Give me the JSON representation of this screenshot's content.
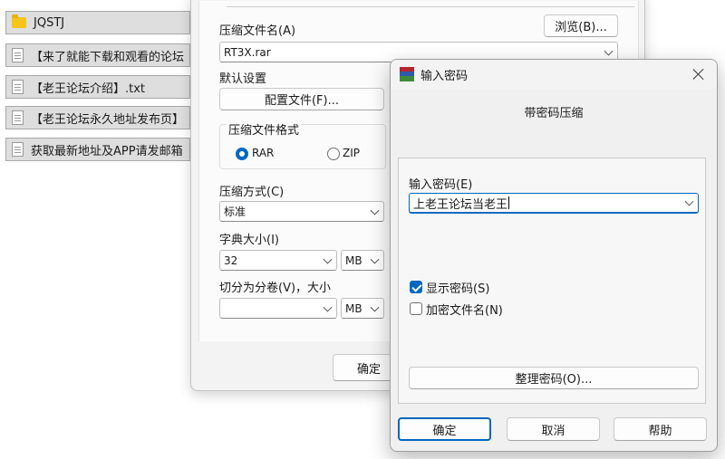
{
  "file_list": {
    "items": [
      {
        "name": "JQSTJ",
        "icon": "folder-icon"
      },
      {
        "name": "【来了就能下载和观看的论坛",
        "icon": "document-icon"
      },
      {
        "name": "【老王论坛介绍】.txt",
        "icon": "document-icon"
      },
      {
        "name": "【老王论坛永久地址发布页】",
        "icon": "document-icon"
      },
      {
        "name": "获取最新地址及APP请发邮箱",
        "icon": "document-icon"
      }
    ]
  },
  "archive_dialog": {
    "archive_name_label": "压缩文件名(A)",
    "browse_button": "浏览(B)...",
    "archive_name_value": "RT3X.rar",
    "default_settings_label": "默认设置",
    "profiles_button": "配置文件(F)...",
    "format_group_label": "压缩文件格式",
    "format_options": [
      "RAR",
      "ZIP"
    ],
    "format_selected": "RAR",
    "method_label": "压缩方式(C)",
    "method_value": "标准",
    "dict_label": "字典大小(I)",
    "dict_value": "32",
    "dict_unit": "MB",
    "split_label": "切分为分卷(V)，大小",
    "split_value": "",
    "split_unit": "MB",
    "ok_button": "确定"
  },
  "password_dialog": {
    "title": "输入密码",
    "subtitle": "带密码压缩",
    "password_label": "输入密码(E)",
    "password_value": "上老王论坛当老王",
    "show_password_label": "显示密码(S)",
    "show_password_checked": true,
    "encrypt_names_label": "加密文件名(N)",
    "encrypt_names_checked": false,
    "organize_button": "整理密码(O)...",
    "ok_button": "确定",
    "cancel_button": "取消",
    "help_button": "帮助"
  },
  "colors": {
    "accent": "#0067c0",
    "file_item_bg": "#dedede",
    "dialog_bg": "#f0f0f0"
  }
}
